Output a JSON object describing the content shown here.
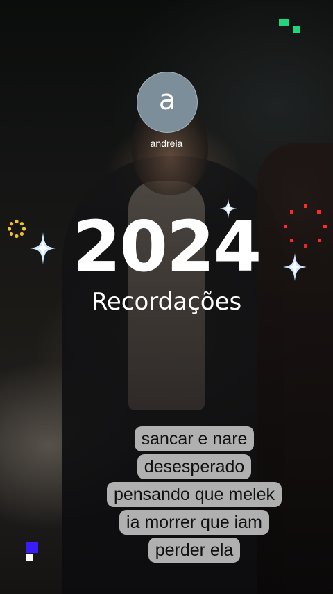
{
  "profile": {
    "avatar_letter": "a",
    "username": "andreia"
  },
  "title": {
    "year": "2024",
    "subtitle": "Recordações"
  },
  "caption": {
    "lines": [
      "sancar e nare",
      "desesperado",
      "pensando que melek",
      "ia morrer que  iam",
      "perder ela"
    ]
  },
  "colors": {
    "avatar_bg": "#7b8e99",
    "sparkle": "#cfe6ff",
    "ring_gold": "#f2c12e",
    "dots_red": "#ff2a2a",
    "pixel_green": "#1fd67f",
    "pixel_blue": "#3b1cff"
  },
  "decorations": {
    "icons": [
      "sparkle-icon",
      "sparkle-icon",
      "sparkle-icon",
      "gold-dotted-ring-icon",
      "red-dotted-circle-icon",
      "green-pixel-icon",
      "blue-pixel-icon"
    ]
  }
}
